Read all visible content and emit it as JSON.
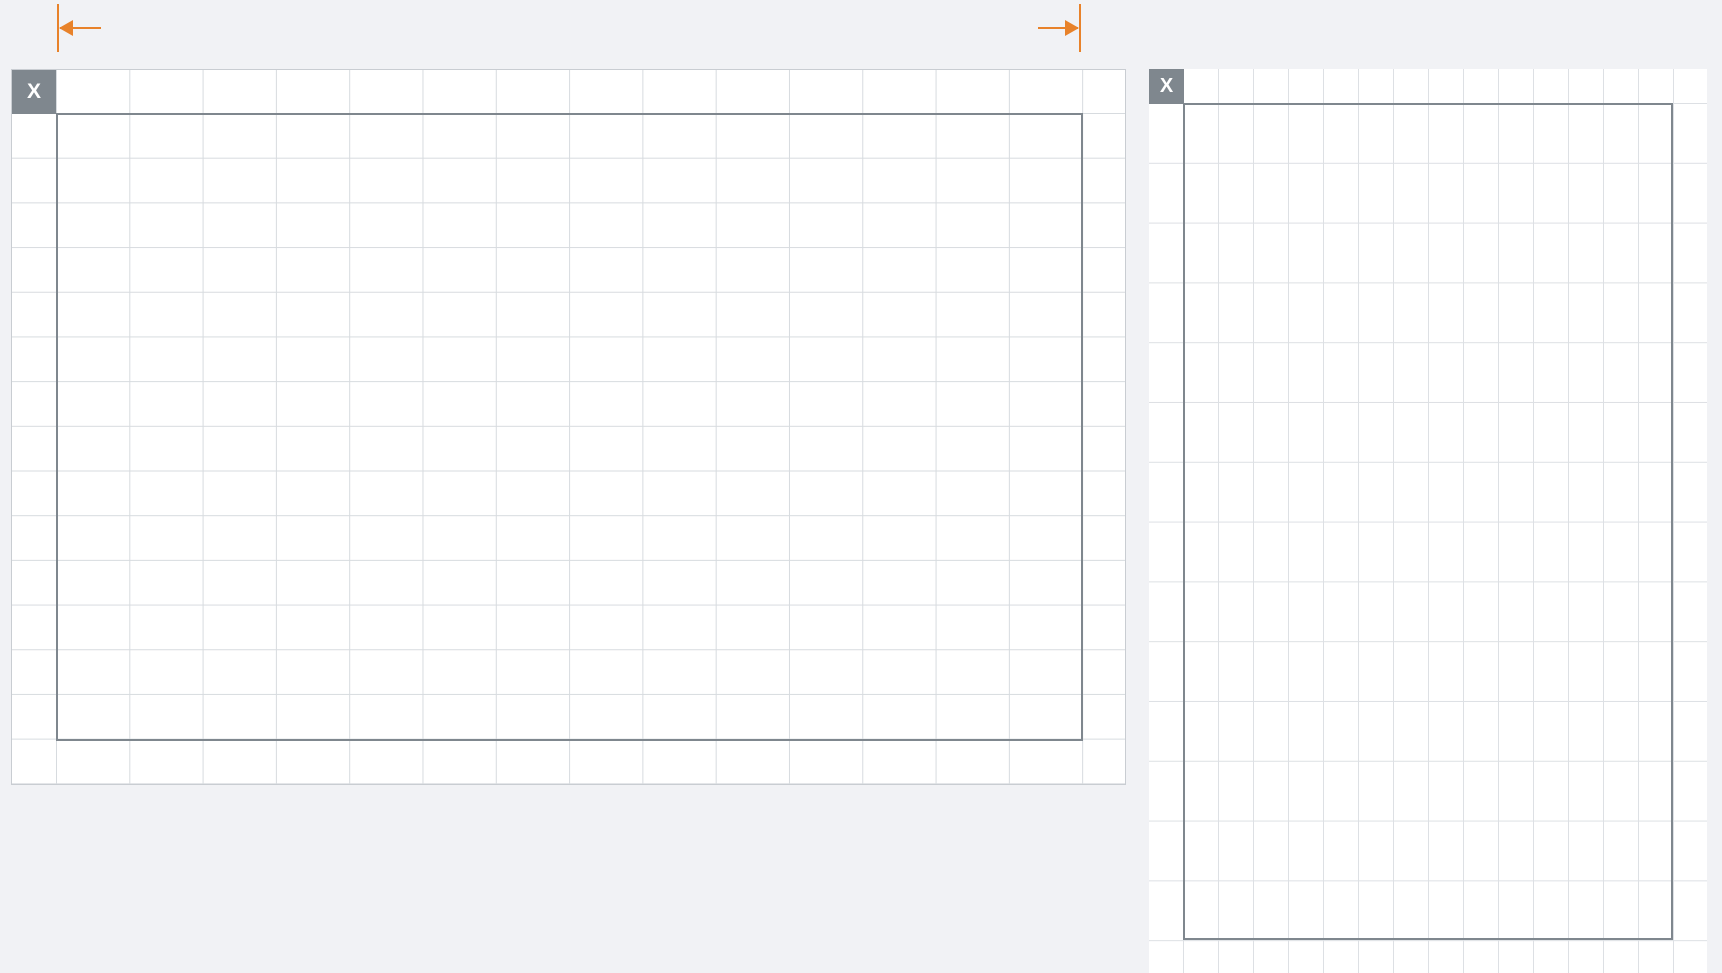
{
  "diagram": {
    "left_panel": {
      "corner_label": "X"
    },
    "right_panel": {
      "corner_label": "X"
    },
    "colors": {
      "background": "#f1f2f5",
      "panel": "#ffffff",
      "grid_line": "#d7dbdf",
      "frame": "#7f878e",
      "corner_box": "#7f878e",
      "corner_text": "#ffffff",
      "dimension_arrow": "#e8822a"
    },
    "icons": [
      "left-arrow-icon",
      "right-arrow-icon"
    ]
  }
}
